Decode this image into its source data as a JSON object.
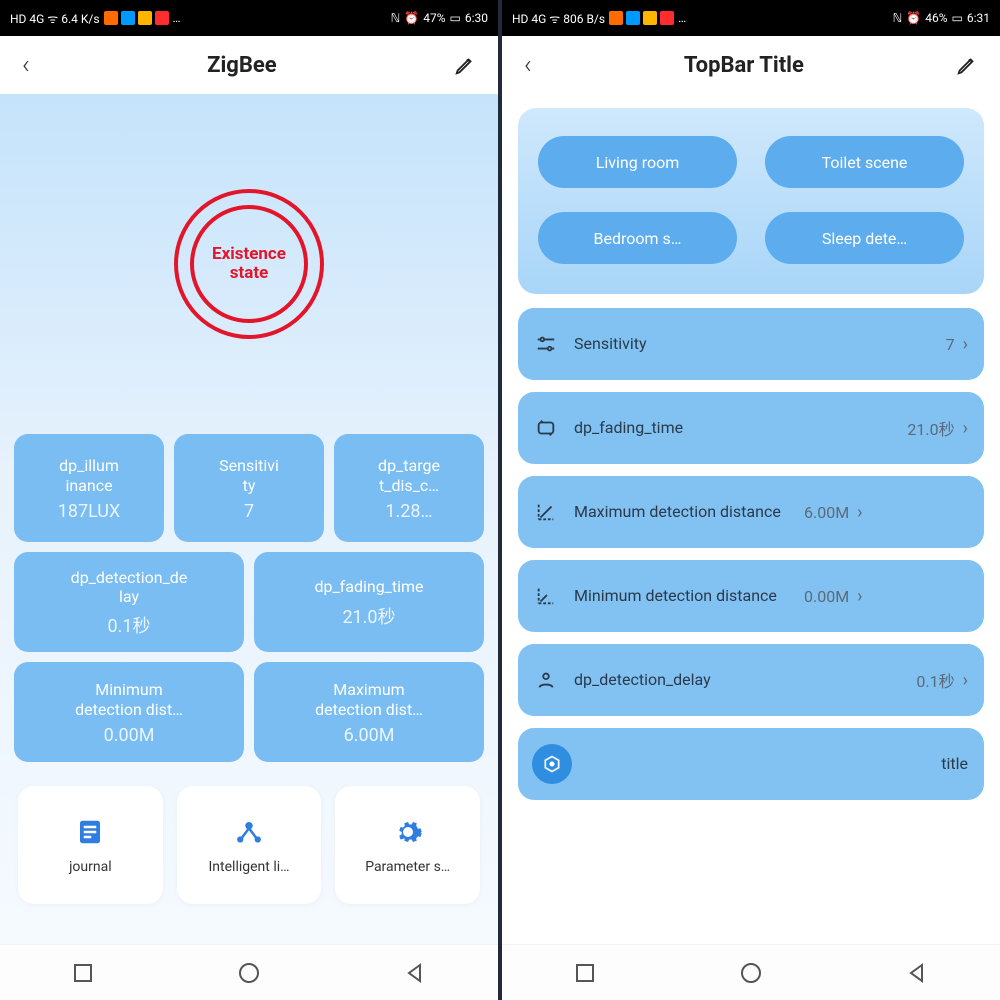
{
  "left": {
    "status": {
      "net": "HD 4G ᯤ 6.4 K/s",
      "bat": "47%",
      "time": "6:30",
      "nfc": "ℕ",
      "alarm": "⏰"
    },
    "title": "ZigBee",
    "hero_label_1": "Existence",
    "hero_label_2": "state",
    "tiles3": [
      {
        "label": "dp_illum\ninance",
        "value": "187LUX"
      },
      {
        "label": "Sensitivi\nty",
        "value": "7"
      },
      {
        "label": "dp_targe\nt_dis_c…",
        "value": "1.28…"
      }
    ],
    "tiles2a": [
      {
        "label": "dp_detection_de\nlay",
        "value": "0.1秒"
      },
      {
        "label": "dp_fading_time",
        "value": "21.0秒"
      }
    ],
    "tiles2b": [
      {
        "label": "Minimum\ndetection dist…",
        "value": "0.00M"
      },
      {
        "label": "Maximum\ndetection dist…",
        "value": "6.00M"
      }
    ],
    "bottom": [
      {
        "label": "journal"
      },
      {
        "label": "Intelligent li…"
      },
      {
        "label": "Parameter s…"
      }
    ]
  },
  "right": {
    "status": {
      "net": "HD 4G ᯤ 806 B/s",
      "bat": "46%",
      "time": "6:31",
      "nfc": "ℕ",
      "alarm": "⏰"
    },
    "title": "TopBar Title",
    "scenes": [
      "Living room",
      "Toilet scene",
      "Bedroom s…",
      "Sleep dete…"
    ],
    "rows": [
      {
        "label": "Sensitivity",
        "value": "7"
      },
      {
        "label": "dp_fading_time",
        "value": "21.0秒"
      },
      {
        "label": "Maximum detection distance",
        "value": "6.00M"
      },
      {
        "label": "Minimum detection distance",
        "value": "0.00M"
      },
      {
        "label": "dp_detection_delay",
        "value": "0.1秒"
      }
    ],
    "last_row": {
      "label": "title"
    }
  }
}
